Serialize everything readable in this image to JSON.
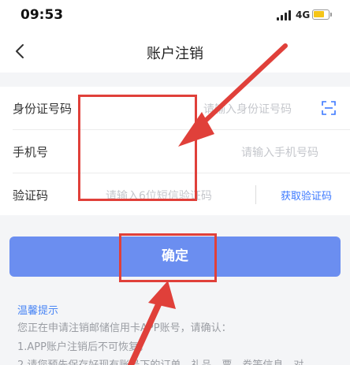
{
  "status_bar": {
    "time": "09:53",
    "network": "4G",
    "battery_color": "#f5c518"
  },
  "nav": {
    "title": "账户注销",
    "back_icon": "chevron-left-icon"
  },
  "form": {
    "id_label": "身份证号码",
    "id_placeholder": "请输入身份证号码",
    "phone_label": "手机号",
    "phone_placeholder": "请输入手机号码",
    "code_label": "验证码",
    "code_placeholder": "请输入6位短信验证码",
    "get_code_label": "获取验证码",
    "scan_icon": "scan-icon"
  },
  "confirm_button": {
    "label": "确定",
    "color": "#6b8ef0"
  },
  "tips": {
    "title": "温馨提示",
    "lines": [
      "您正在申请注销邮储信用卡APP账号，请确认：",
      "1.APP账户注销后不可恢复。",
      "2.请您预先保存好现有账号下的订单、礼品、票、券等信息，对"
    ]
  },
  "annotation_color": "#e0403a"
}
